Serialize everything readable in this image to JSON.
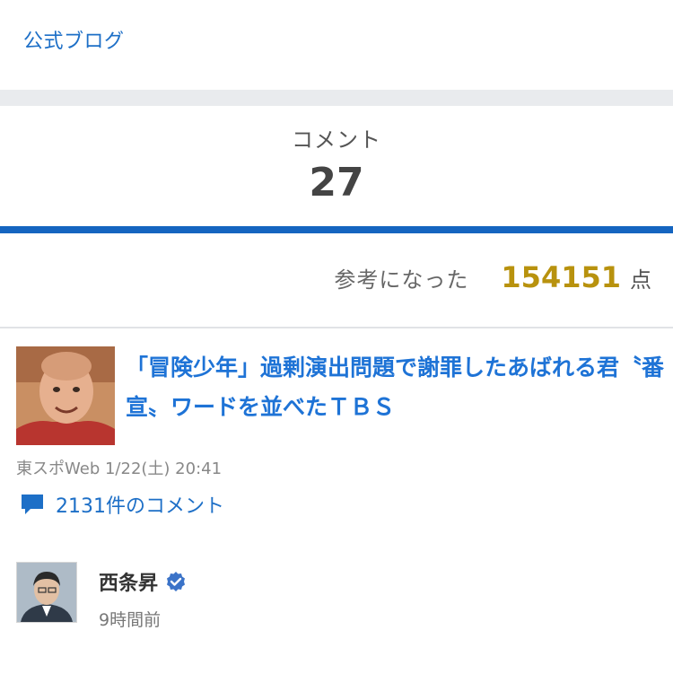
{
  "header": {
    "blog_link": "公式ブログ"
  },
  "tabs": {
    "comment_label": "コメント",
    "comment_count": "27"
  },
  "helpful": {
    "label": "参考になった",
    "score": "154151",
    "unit": "点"
  },
  "article": {
    "title": "「冒険少年」過剰演出問題で謝罪したあばれる君〝番宣〟ワードを並べたＴＢＳ",
    "source": "東スポWeb",
    "datetime": "1/22(土) 20:41",
    "comment_count_text": "2131件のコメント",
    "thumb_icon": "person-photo"
  },
  "author": {
    "name": "西条昇",
    "time_ago": "9時間前",
    "verified_icon": "verified-check-icon"
  },
  "colors": {
    "link_blue": "#1d6fc7",
    "tab_underline": "#1565c0",
    "score_gold": "#b8920e"
  }
}
